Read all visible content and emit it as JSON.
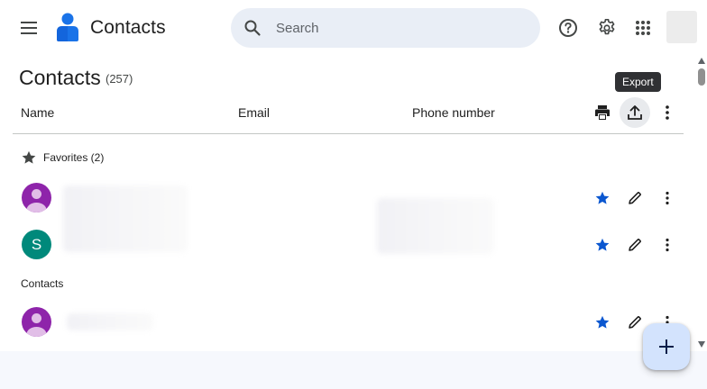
{
  "header": {
    "app_title": "Contacts",
    "search_placeholder": "Search",
    "icons": [
      "menu-icon",
      "contacts-logo-icon",
      "search-icon",
      "help-icon",
      "settings-icon",
      "apps-icon"
    ]
  },
  "main": {
    "title": "Contacts",
    "count": "(257)",
    "tooltip": "Export",
    "columns": [
      "Name",
      "Email",
      "Phone number"
    ],
    "header_actions": [
      "print-icon",
      "export-icon",
      "more-vert-icon"
    ]
  },
  "favorites": {
    "label": "Favorites (2)",
    "rows": [
      {
        "avatar_type": "person",
        "avatar_color": "#8e24aa",
        "avatar_letter": "",
        "starred": true
      },
      {
        "avatar_type": "letter",
        "avatar_color": "#00897b",
        "avatar_letter": "S",
        "starred": true
      }
    ]
  },
  "contacts": {
    "label": "Contacts",
    "rows": [
      {
        "avatar_type": "person",
        "avatar_color": "#8e24aa",
        "avatar_letter": "",
        "starred": true
      }
    ]
  },
  "colors": {
    "accent_blue": "#0b57d0",
    "search_bg": "#e9eef6",
    "fab_bg": "#d3e3fd"
  }
}
